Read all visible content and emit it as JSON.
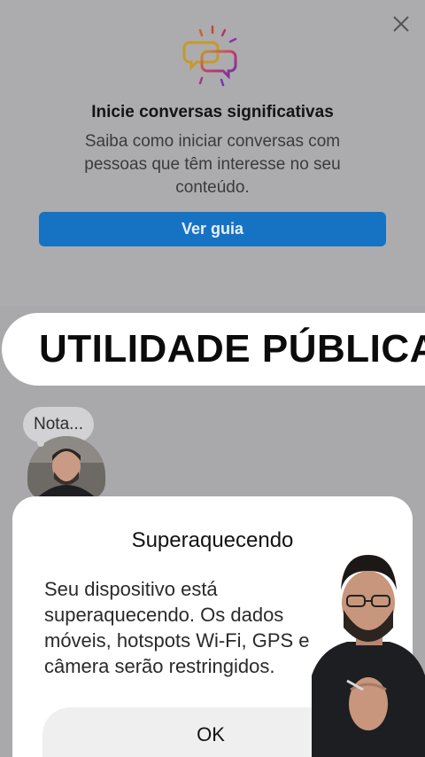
{
  "promo": {
    "title": "Inicie conversas significativas",
    "body": "Saiba como iniciar conversas com pessoas que têm interesse no seu conteúdo.",
    "button_label": "Ver guia",
    "close_icon": "close-icon",
    "promo_icon": "chat-bubbles-sparkle-icon"
  },
  "banner": {
    "text": "UTILIDADE PÚBLICA"
  },
  "note": {
    "text": "Nota..."
  },
  "dialog": {
    "title": "Superaquecendo",
    "body": "Seu dispositivo está superaquecendo. Os dados móveis, hotspots Wi-Fi, GPS e câmera serão restringidos.",
    "ok_label": "OK"
  },
  "colors": {
    "accent": "#1673c3",
    "background": "#a9a9ab",
    "banner": "#ffffff"
  }
}
